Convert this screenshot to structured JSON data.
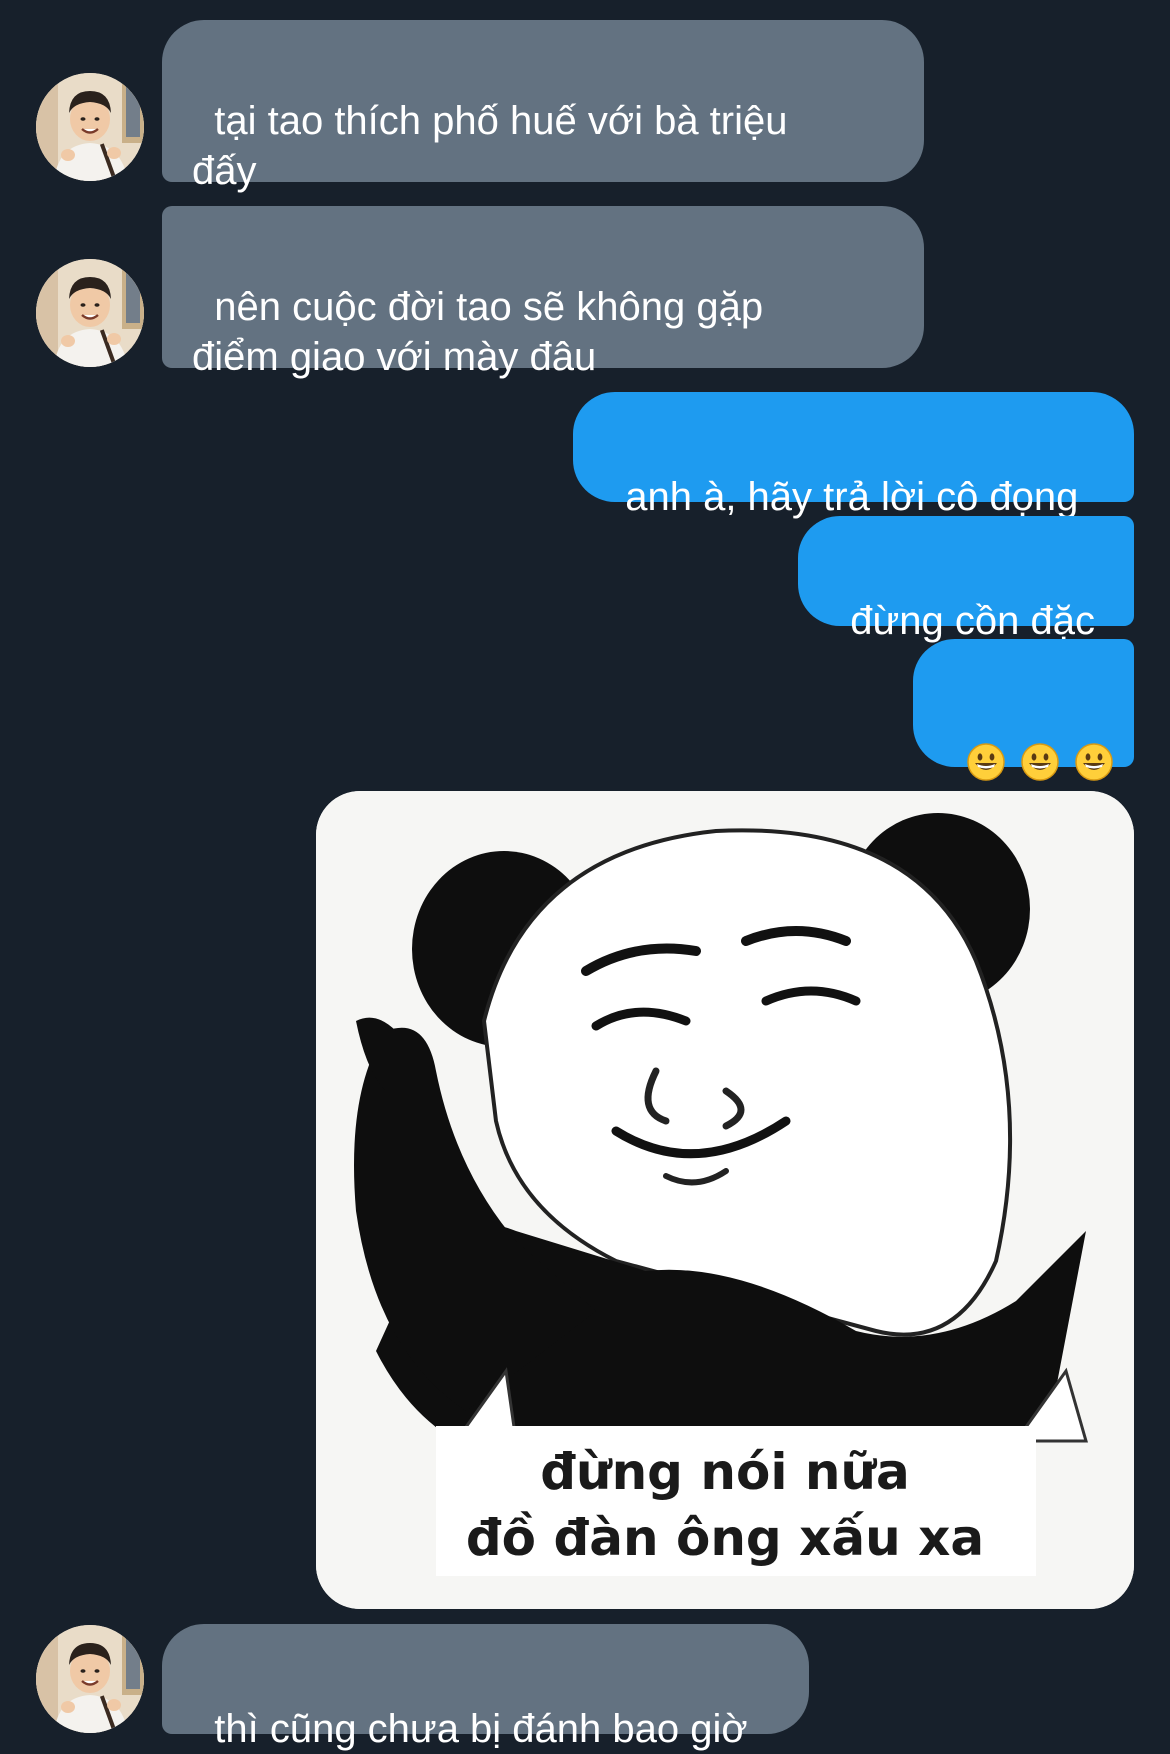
{
  "messages": [
    {
      "sender": "them",
      "text": "tại tao thích phố huế với bà triệu\nđấy"
    },
    {
      "sender": "them",
      "text": "nên cuộc đời tao sẽ không gặp\nđiểm giao với mày đâu"
    },
    {
      "sender": "me",
      "text": "anh à, hãy trả lời cô đọng"
    },
    {
      "sender": "me",
      "text": "đừng cồn đặc"
    },
    {
      "sender": "me",
      "emoji": [
        "grinning-face-emoji",
        "grinning-face-emoji",
        "grinning-face-emoji"
      ]
    },
    {
      "sender": "me",
      "sticker": {
        "caption_line1": "đừng nói nữa",
        "caption_line2": "đồ đàn ông xấu xa"
      }
    },
    {
      "sender": "them",
      "text": "thì cũng chưa bị đánh bao giờ"
    }
  ],
  "colors": {
    "background": "#17202b",
    "incoming_bubble": "#637281",
    "outgoing_bubble": "#1e9bf0",
    "text": "#ffffff"
  }
}
